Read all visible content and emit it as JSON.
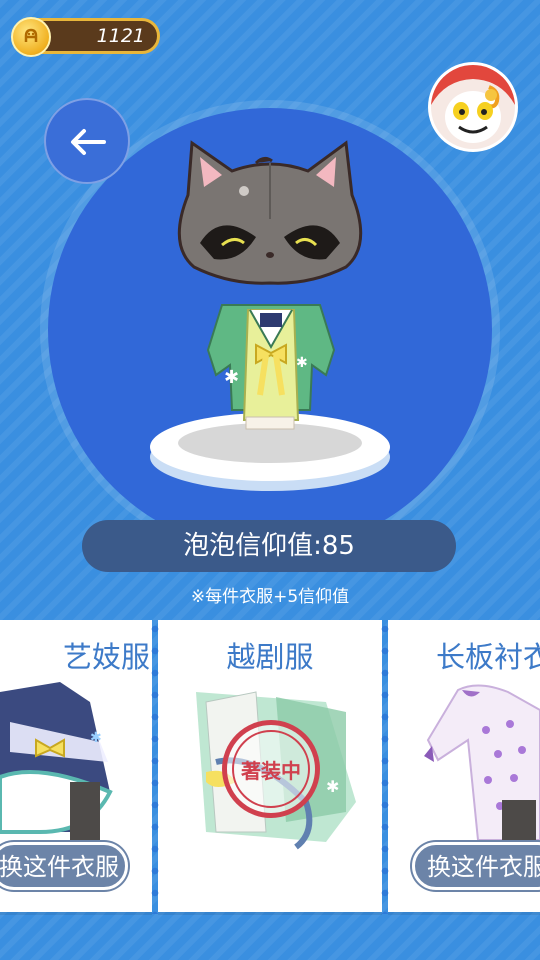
{
  "header": {
    "coins": "1121"
  },
  "stage": {
    "faith_text": "泡泡信仰值:85",
    "hint": "※每件衣服+5信仰值"
  },
  "outfits": [
    {
      "title": "艺妓服",
      "button": "换这件衣服"
    },
    {
      "title": "越剧服",
      "stamp": "著装中"
    },
    {
      "title": "长板衬衣",
      "button": "换这件衣服"
    }
  ],
  "colors": {
    "background": "#3a8fe0",
    "stage": "#3168d8",
    "title_text": "#3d7ac8",
    "stamp": "#d0404e"
  },
  "icons": [
    "coin-icon",
    "back-arrow-icon",
    "avatar-icon"
  ]
}
